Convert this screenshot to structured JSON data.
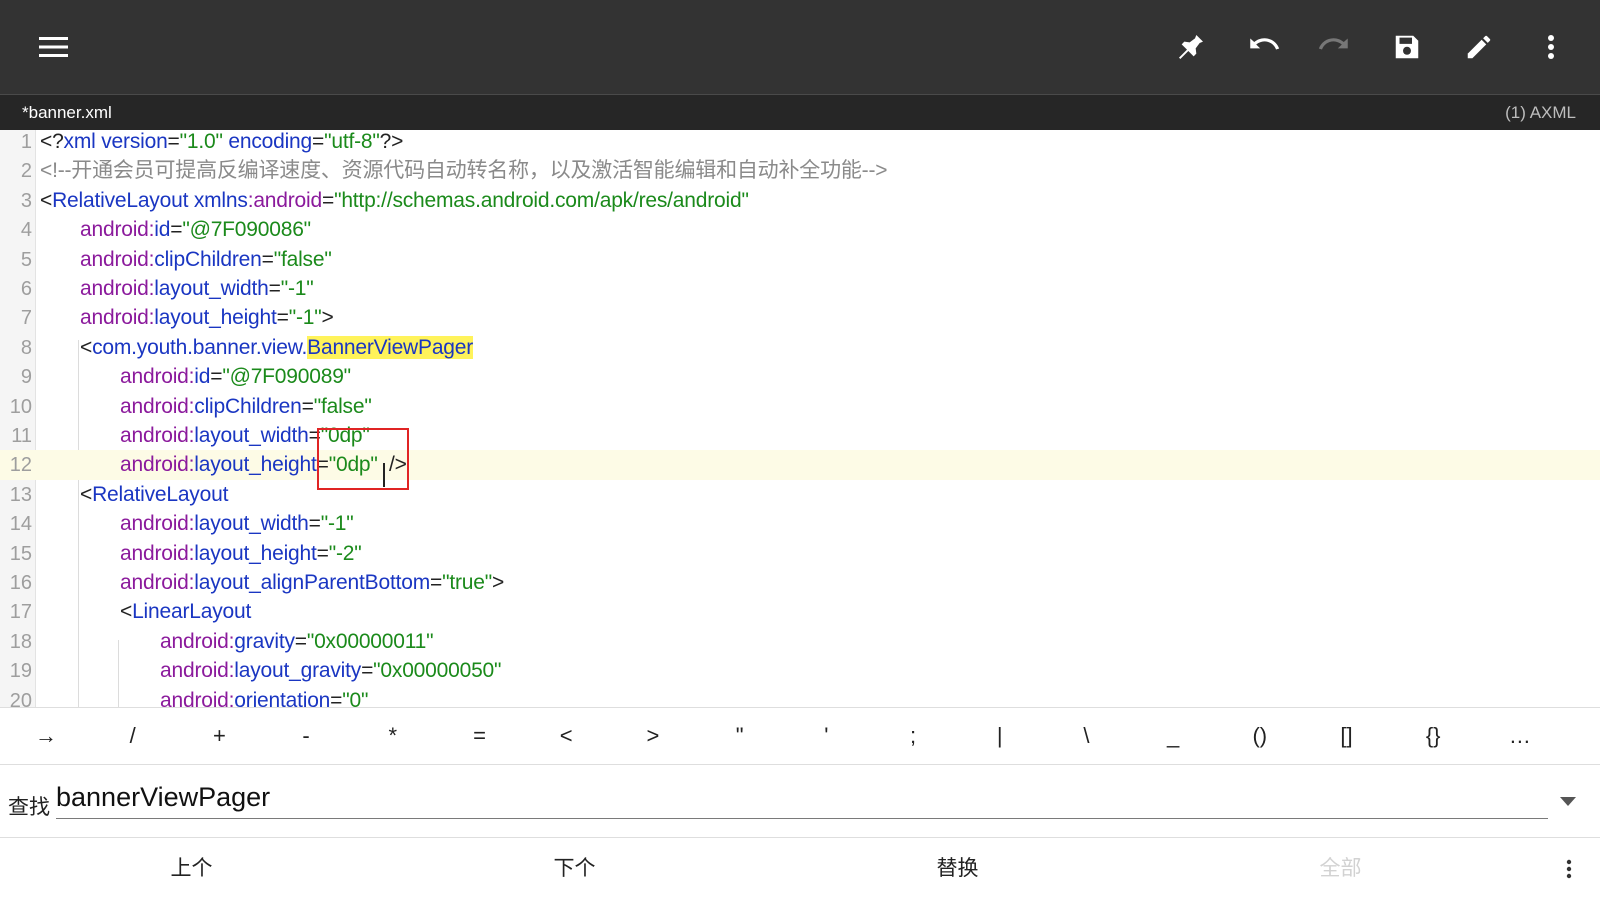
{
  "toolbar": {
    "menu_icon": "hamburger-menu-icon",
    "actions": [
      "pin-icon",
      "undo-icon",
      "redo-icon",
      "save-icon",
      "edit-icon",
      "more-vert-icon"
    ]
  },
  "tab": {
    "title": "*banner.xml",
    "info": "(1)  AXML"
  },
  "editor": {
    "lines": [
      {
        "n": "1",
        "indent": 0,
        "tokens": [
          [
            "br",
            "<?"
          ],
          [
            "tag",
            "xml"
          ],
          [
            "br",
            " "
          ],
          [
            "attr",
            "version"
          ],
          [
            "eq",
            "="
          ],
          [
            "val",
            "\"1.0\""
          ],
          [
            "br",
            " "
          ],
          [
            "attr",
            "encoding"
          ],
          [
            "eq",
            "="
          ],
          [
            "val",
            "\"utf-8\""
          ],
          [
            "br",
            "?>"
          ]
        ]
      },
      {
        "n": "2",
        "indent": 0,
        "tokens": [
          [
            "cmt",
            "<!--开通会员可提高反编译速度、资源代码自动转名称，以及激活智能编辑和自动补全功能-->"
          ]
        ]
      },
      {
        "n": "3",
        "indent": 0,
        "tokens": [
          [
            "br",
            "<"
          ],
          [
            "tag",
            "RelativeLayout"
          ],
          [
            "br",
            " "
          ],
          [
            "attr",
            "xmlns"
          ],
          [
            "ns",
            ":android"
          ],
          [
            "eq",
            "="
          ],
          [
            "val",
            "\"http://schemas.android.com/apk/res/android\""
          ]
        ]
      },
      {
        "n": "4",
        "indent": 1,
        "tokens": [
          [
            "ns",
            "android:"
          ],
          [
            "attr",
            "id"
          ],
          [
            "eq",
            "="
          ],
          [
            "val",
            "\"@7F090086\""
          ]
        ]
      },
      {
        "n": "5",
        "indent": 1,
        "tokens": [
          [
            "ns",
            "android:"
          ],
          [
            "attr",
            "clipChildren"
          ],
          [
            "eq",
            "="
          ],
          [
            "val",
            "\"false\""
          ]
        ]
      },
      {
        "n": "6",
        "indent": 1,
        "tokens": [
          [
            "ns",
            "android:"
          ],
          [
            "attr",
            "layout_width"
          ],
          [
            "eq",
            "="
          ],
          [
            "val",
            "\"-1\""
          ]
        ]
      },
      {
        "n": "7",
        "indent": 1,
        "tokens": [
          [
            "ns",
            "android:"
          ],
          [
            "attr",
            "layout_height"
          ],
          [
            "eq",
            "="
          ],
          [
            "val",
            "\"-1\""
          ],
          [
            "br",
            ">"
          ]
        ]
      },
      {
        "n": "8",
        "indent": 1,
        "tokens": [
          [
            "br",
            "<"
          ],
          [
            "tag",
            "com.youth.banner.view."
          ],
          [
            "hl",
            "BannerViewPager"
          ]
        ]
      },
      {
        "n": "9",
        "indent": 2,
        "tokens": [
          [
            "ns",
            "android:"
          ],
          [
            "attr",
            "id"
          ],
          [
            "eq",
            "="
          ],
          [
            "val",
            "\"@7F090089\""
          ]
        ]
      },
      {
        "n": "10",
        "indent": 2,
        "tokens": [
          [
            "ns",
            "android:"
          ],
          [
            "attr",
            "clipChildren"
          ],
          [
            "eq",
            "="
          ],
          [
            "val",
            "\"false\""
          ]
        ]
      },
      {
        "n": "11",
        "indent": 2,
        "tokens": [
          [
            "ns",
            "android:"
          ],
          [
            "attr",
            "layout_width"
          ],
          [
            "eq",
            "="
          ],
          [
            "val",
            "\"0dp\""
          ]
        ]
      },
      {
        "n": "12",
        "indent": 2,
        "current": true,
        "tokens": [
          [
            "ns",
            "android:"
          ],
          [
            "attr",
            "layout_height"
          ],
          [
            "eq",
            "="
          ],
          [
            "val",
            "\"0dp\""
          ],
          [
            "br",
            "  />"
          ]
        ]
      },
      {
        "n": "13",
        "indent": 1,
        "tokens": [
          [
            "br",
            "<"
          ],
          [
            "tag",
            "RelativeLayout"
          ]
        ]
      },
      {
        "n": "14",
        "indent": 2,
        "tokens": [
          [
            "ns",
            "android:"
          ],
          [
            "attr",
            "layout_width"
          ],
          [
            "eq",
            "="
          ],
          [
            "val",
            "\"-1\""
          ]
        ]
      },
      {
        "n": "15",
        "indent": 2,
        "tokens": [
          [
            "ns",
            "android:"
          ],
          [
            "attr",
            "layout_height"
          ],
          [
            "eq",
            "="
          ],
          [
            "val",
            "\"-2\""
          ]
        ]
      },
      {
        "n": "16",
        "indent": 2,
        "tokens": [
          [
            "ns",
            "android:"
          ],
          [
            "attr",
            "layout_alignParentBottom"
          ],
          [
            "eq",
            "="
          ],
          [
            "val",
            "\"true\""
          ],
          [
            "br",
            ">"
          ]
        ]
      },
      {
        "n": "17",
        "indent": 2,
        "tokens": [
          [
            "br",
            "<"
          ],
          [
            "tag",
            "LinearLayout"
          ]
        ]
      },
      {
        "n": "18",
        "indent": 3,
        "tokens": [
          [
            "ns",
            "android:"
          ],
          [
            "attr",
            "gravity"
          ],
          [
            "eq",
            "="
          ],
          [
            "val",
            "\"0x00000011\""
          ]
        ]
      },
      {
        "n": "19",
        "indent": 3,
        "tokens": [
          [
            "ns",
            "android:"
          ],
          [
            "attr",
            "layout_gravity"
          ],
          [
            "eq",
            "="
          ],
          [
            "val",
            "\"0x00000050\""
          ]
        ]
      },
      {
        "n": "20",
        "indent": 3,
        "tokens": [
          [
            "ns",
            "android:"
          ],
          [
            "attr",
            "orientation"
          ],
          [
            "eq",
            "="
          ],
          [
            "val",
            "\"0\""
          ]
        ]
      }
    ]
  },
  "symbols": [
    "→",
    "/",
    "+",
    "-",
    "*",
    "=",
    "<",
    ">",
    "\"",
    "'",
    ";",
    "|",
    "\\",
    "_",
    "()",
    "[]",
    "{}",
    "…"
  ],
  "find": {
    "label": "查找",
    "value": "bannerViewPager",
    "dropdown_icon": "dropdown-arrow-icon"
  },
  "actions": {
    "prev": "上个",
    "next": "下个",
    "replace": "替换",
    "all": "全部",
    "more_icon": "more-vert-icon"
  }
}
